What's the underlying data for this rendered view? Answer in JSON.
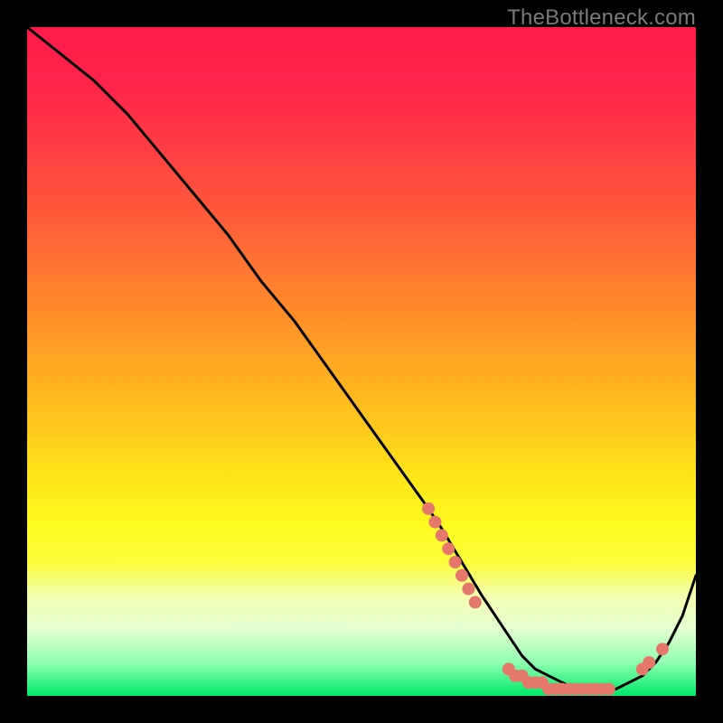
{
  "watermark": "TheBottleneck.com",
  "chart_data": {
    "type": "line",
    "title": "",
    "xlabel": "",
    "ylabel": "",
    "xlim": [
      0,
      100
    ],
    "ylim": [
      0,
      100
    ],
    "series": [
      {
        "name": "curve",
        "x": [
          0,
          5,
          10,
          15,
          20,
          25,
          30,
          35,
          40,
          45,
          50,
          55,
          60,
          62,
          65,
          68,
          70,
          72,
          74,
          76,
          78,
          80,
          82,
          84,
          86,
          88,
          90,
          92,
          94,
          96,
          98,
          100
        ],
        "y": [
          100,
          96,
          92,
          87,
          81,
          75,
          69,
          62,
          56,
          49,
          42,
          35,
          28,
          25,
          20,
          15,
          12,
          9,
          6,
          4,
          3,
          2,
          1,
          1,
          1,
          1,
          2,
          3,
          5,
          8,
          12,
          18
        ]
      }
    ],
    "markers": {
      "comment": "salmon-colored dot clusters along the curve",
      "color": "#e6776b",
      "points": [
        {
          "x": 60,
          "y": 28
        },
        {
          "x": 61,
          "y": 26
        },
        {
          "x": 62,
          "y": 24
        },
        {
          "x": 63,
          "y": 22
        },
        {
          "x": 64,
          "y": 20
        },
        {
          "x": 65,
          "y": 18
        },
        {
          "x": 66,
          "y": 16
        },
        {
          "x": 67,
          "y": 14
        },
        {
          "x": 72,
          "y": 4
        },
        {
          "x": 73,
          "y": 3
        },
        {
          "x": 74,
          "y": 3
        },
        {
          "x": 75,
          "y": 2
        },
        {
          "x": 76,
          "y": 2
        },
        {
          "x": 77,
          "y": 2
        },
        {
          "x": 78,
          "y": 1
        },
        {
          "x": 79,
          "y": 1
        },
        {
          "x": 80,
          "y": 1
        },
        {
          "x": 81,
          "y": 1
        },
        {
          "x": 82,
          "y": 1
        },
        {
          "x": 83,
          "y": 1
        },
        {
          "x": 84,
          "y": 1
        },
        {
          "x": 85,
          "y": 1
        },
        {
          "x": 86,
          "y": 1
        },
        {
          "x": 87,
          "y": 1
        },
        {
          "x": 92,
          "y": 4
        },
        {
          "x": 93,
          "y": 5
        },
        {
          "x": 95,
          "y": 7
        }
      ]
    },
    "background_gradient": {
      "top": "#ff1a4a",
      "upper_mid": "#ffb81f",
      "lower_mid": "#fff91f",
      "bottom": "#00e868"
    }
  }
}
